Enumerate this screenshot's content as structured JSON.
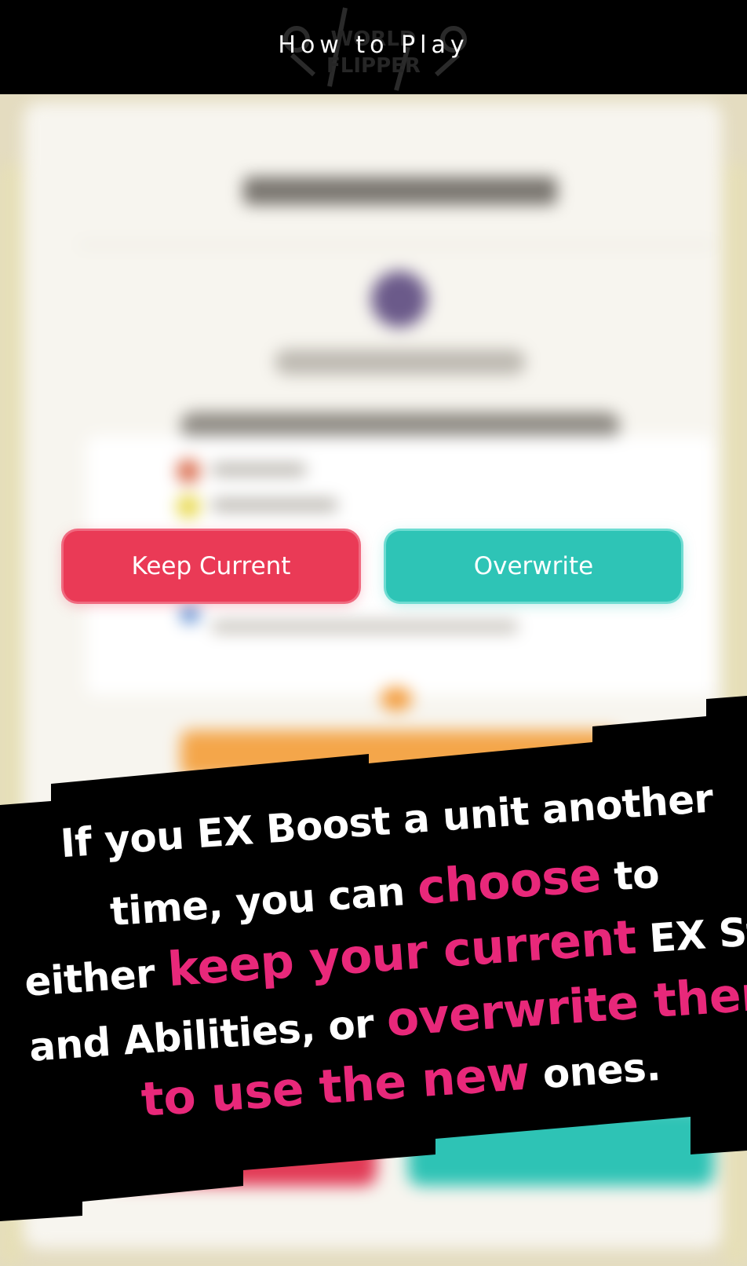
{
  "header": {
    "title": "How to Play",
    "logo_text": "WORLD FLIPPER"
  },
  "buttons": {
    "keep_label": "Keep Current",
    "overwrite_label": "Overwrite"
  },
  "caption": {
    "line1": "If you EX Boost a unit another",
    "line2_a": "time, you can",
    "line2_b": "choose",
    "line2_c": "to",
    "line3_a": "either",
    "line3_b": "keep your current",
    "line3_c": "EX Stats",
    "line4_a": "and Abilities, or",
    "line4_b": "overwrite them",
    "line5_a": "to use the new",
    "line5_b": "ones."
  },
  "colors": {
    "keep": "#ea3a56",
    "overwrite": "#2ec4b6",
    "highlight": "#e8287a",
    "banner": "#000000"
  }
}
